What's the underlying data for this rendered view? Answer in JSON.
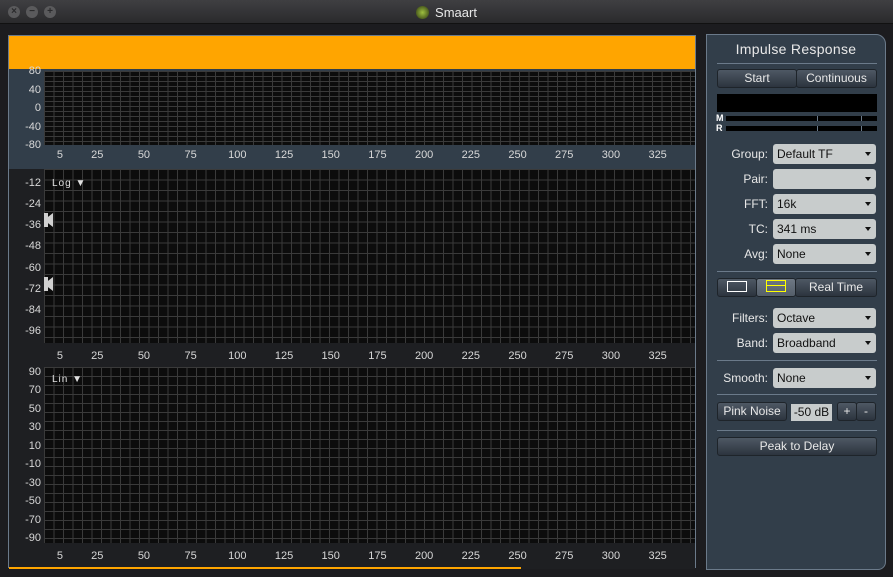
{
  "window": {
    "title": "Smaart",
    "controls": [
      "close",
      "minimize",
      "zoom"
    ]
  },
  "plots": {
    "x_ticks": [
      "5",
      "25",
      "50",
      "75",
      "100",
      "125",
      "150",
      "175",
      "200",
      "225",
      "250",
      "275",
      "300",
      "325"
    ],
    "x_values": [
      5,
      25,
      50,
      75,
      100,
      125,
      150,
      175,
      200,
      225,
      250,
      275,
      300,
      325
    ],
    "x_range": [
      -3.5,
      345
    ],
    "pane1": {
      "y_ticks": [
        "80",
        "40",
        "0",
        "-40",
        "-80"
      ]
    },
    "pane2": {
      "scale": "Log",
      "y_ticks": [
        "-12",
        "-24",
        "-36",
        "-48",
        "-60",
        "-72",
        "-84",
        "-96"
      ],
      "markers": [
        -28,
        -66
      ]
    },
    "pane3": {
      "scale": "Lin",
      "y_ticks": [
        "90",
        "70",
        "50",
        "30",
        "10",
        "-10",
        "-30",
        "-50",
        "-70",
        "-90"
      ]
    }
  },
  "sidebar": {
    "title": "Impulse Response",
    "start_label": "Start",
    "continuous_label": "Continuous",
    "meter_labels": {
      "m": "M",
      "r": "R"
    },
    "fields": {
      "group": {
        "label": "Group:",
        "value": "Default TF"
      },
      "pair": {
        "label": "Pair:",
        "value": ""
      },
      "fft": {
        "label": "FFT:",
        "value": "16k"
      },
      "tc": {
        "label": "TC:",
        "value": "341 ms"
      },
      "avg": {
        "label": "Avg:",
        "value": "None"
      },
      "filters": {
        "label": "Filters:",
        "value": "Octave"
      },
      "band": {
        "label": "Band:",
        "value": "Broadband"
      },
      "smooth": {
        "label": "Smooth:",
        "value": "None"
      }
    },
    "view_buttons": {
      "single": "single-pane-icon",
      "split": "split-pane-icon",
      "realtime_label": "Real Time"
    },
    "pink_noise_label": "Pink Noise",
    "pink_noise_level": "-50 dB",
    "plus_label": "+",
    "minus_label": "-",
    "peak_to_delay_label": "Peak to Delay"
  },
  "colors": {
    "accent": "#ffa500",
    "panel": "#323e4a",
    "plot_bg": "#0c0c0c",
    "grid": "#3a3a3a",
    "split_icon": "#ffff00"
  }
}
